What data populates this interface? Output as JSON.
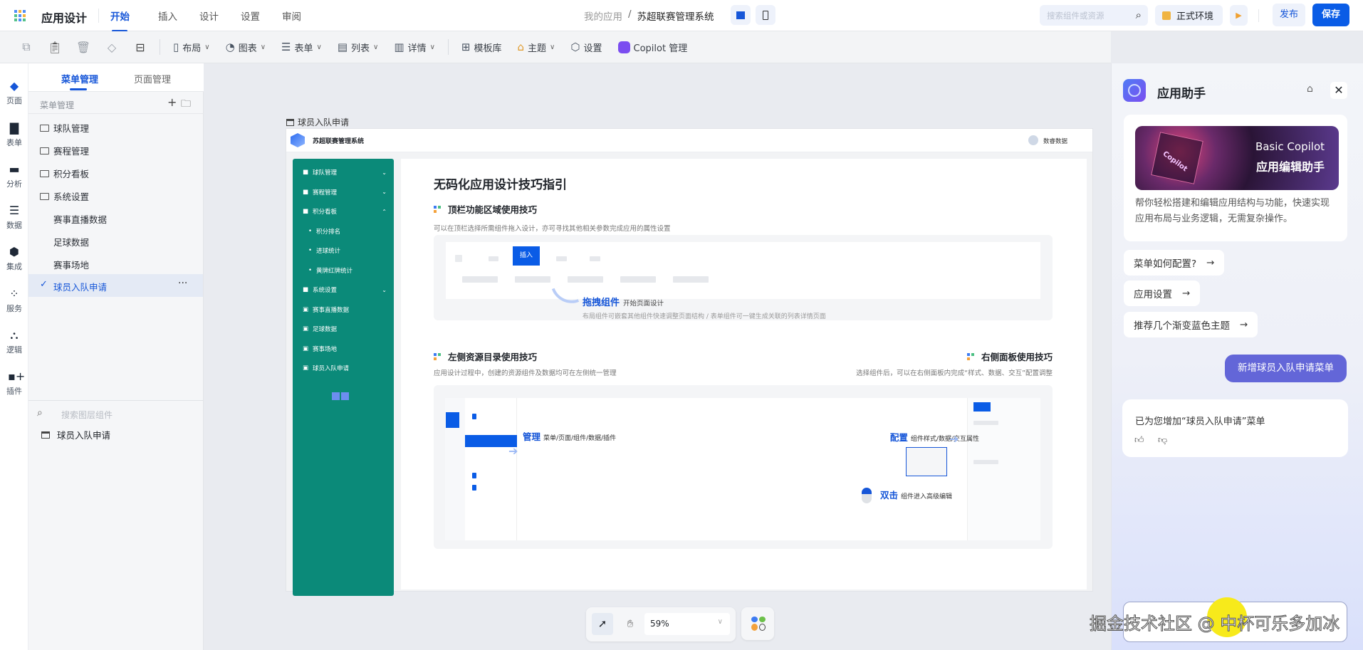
{
  "topbar": {
    "app_title": "应用设计",
    "tabs": [
      "开始",
      "插入",
      "设计",
      "设置",
      "审阅"
    ],
    "active_tab": "开始",
    "breadcrumb": {
      "parent": "我的应用",
      "separator": "/",
      "current": "苏超联赛管理系统"
    },
    "search_placeholder": "搜索组件或资源",
    "env_label": "正式环境",
    "publish": "发布",
    "save": "保存"
  },
  "toolbar": {
    "items": [
      "布局",
      "图表",
      "表单",
      "列表",
      "详情",
      "模板库",
      "主题",
      "设置",
      "Copilot 管理"
    ]
  },
  "rail": {
    "items": [
      "页面",
      "表单",
      "分析",
      "数据",
      "集成",
      "服务",
      "逻辑",
      "插件"
    ]
  },
  "left_panel": {
    "tabs": [
      "菜单管理",
      "页面管理"
    ],
    "section_title": "菜单管理",
    "menu": [
      {
        "label": "球队管理",
        "type": "folder"
      },
      {
        "label": "赛程管理",
        "type": "folder"
      },
      {
        "label": "积分看板",
        "type": "folder"
      },
      {
        "label": "系统设置",
        "type": "folder"
      },
      {
        "label": "赛事直播数据",
        "type": "page"
      },
      {
        "label": "足球数据",
        "type": "page"
      },
      {
        "label": "赛事场地",
        "type": "page"
      },
      {
        "label": "球员入队申请",
        "type": "page",
        "selected": true
      }
    ],
    "search_placeholder": "搜索图层组件",
    "layer": "球员入队申请"
  },
  "canvas": {
    "page_label": "球员入队申请",
    "app_name": "苏超联赛管理系统",
    "brand": "数睿数据",
    "sidebar": [
      {
        "label": "球队管理",
        "chev": "⌄"
      },
      {
        "label": "赛程管理",
        "chev": "⌄"
      },
      {
        "label": "积分看板",
        "chev": "⌃"
      },
      {
        "label": "积分排名",
        "sub": true
      },
      {
        "label": "进球统计",
        "sub": true
      },
      {
        "label": "黄牌红牌统计",
        "sub": true
      },
      {
        "label": "系统设置",
        "chev": "⌄"
      },
      {
        "label": "赛事直播数据"
      },
      {
        "label": "足球数据"
      },
      {
        "label": "赛事场地"
      },
      {
        "label": "球员入队申请"
      }
    ],
    "title": "无码化应用设计技巧指引",
    "s1": {
      "heading": "顶栏功能区域使用技巧",
      "desc": "可以在顶栏选择所需组件拖入设计，亦可寻找其他相关参数完成应用的属性设置",
      "insert": "插入",
      "drag_title": "拖拽组件",
      "drag_sub": "开始页面设计",
      "drag_desc": "布局组件可嵌套其他组件快速调整页面结构 / 表单组件可一键生成关联的列表详情页面"
    },
    "s2": {
      "heading": "左侧资源目录使用技巧",
      "desc": "应用设计过程中，创建的资源组件及数据均可在左侧统一管理",
      "manage_title": "管理",
      "manage_sub": "菜单/页面/组件/数据/插件"
    },
    "s3": {
      "heading": "右侧面板使用技巧",
      "desc": "选择组件后，可以在右侧面板内完成“样式、数据、交互”配置调整",
      "config_title": "配置",
      "config_sub": "组件样式/数据/交互属性",
      "dbl_title": "双击",
      "dbl_sub": "组件进入高级编辑"
    },
    "zoom": "59%"
  },
  "assistant": {
    "title": "应用助手",
    "banner_line1": "Basic Copilot",
    "banner_line2": "应用编辑助手",
    "banner_text": "Copilot",
    "intro": "帮你轻松搭建和编辑应用结构与功能，快速实现应用布局与业务逻辑，无需复杂操作。",
    "suggestions": [
      "菜单如何配置?",
      "应用设置",
      "推荐几个渐变蓝色主题"
    ],
    "user_message": "新增球员入队申请菜单",
    "reply": "已为您增加“球员入队申请”菜单"
  },
  "watermark": "掘金技术社区 @ 中杯可乐多加冰",
  "colors": {
    "primary": "#0a5ce6",
    "green": "#0b8a79",
    "assistant": "#6366d8"
  }
}
